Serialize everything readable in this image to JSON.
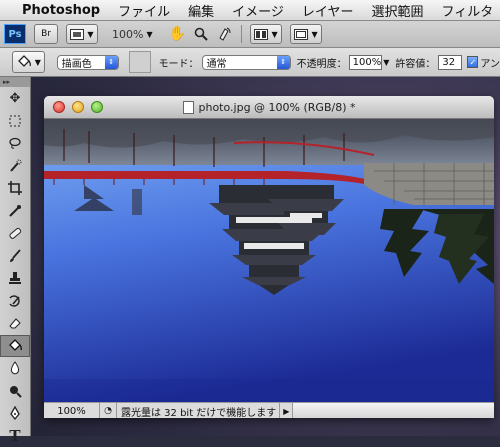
{
  "menubar": {
    "app_name": "Photoshop",
    "items": [
      "ファイル",
      "編集",
      "イメージ",
      "レイヤー",
      "選択範囲",
      "フィルタ"
    ]
  },
  "appbar": {
    "logo": "Ps",
    "bridge": "Br",
    "zoom": "100%"
  },
  "options": {
    "fill_source": "描画色",
    "mode_label": "モード：",
    "mode_value": "通常",
    "opacity_label": "不透明度：",
    "opacity_value": "100%",
    "tolerance_label": "許容値：",
    "tolerance_value": "32",
    "antialias_label": "アン"
  },
  "document": {
    "title": "photo.jpg @ 100% (RGB/8) *",
    "status_zoom": "100%",
    "status_text": "露光量は 32 bit だけで機能します"
  },
  "colors": {
    "sky_top": "#6f9ff0",
    "sky_bottom": "#1f2f9a",
    "bridge": "#b4222a"
  },
  "toolbox": {
    "tools": [
      "move-icon",
      "marquee-icon",
      "lasso-icon",
      "quick-select-icon",
      "crop-icon",
      "eyedropper-icon",
      "healing-brush-icon",
      "brush-icon",
      "clone-stamp-icon",
      "history-brush-icon",
      "eraser-icon",
      "paint-bucket-icon",
      "blur-icon",
      "dodge-icon",
      "pen-icon",
      "type-icon"
    ]
  }
}
